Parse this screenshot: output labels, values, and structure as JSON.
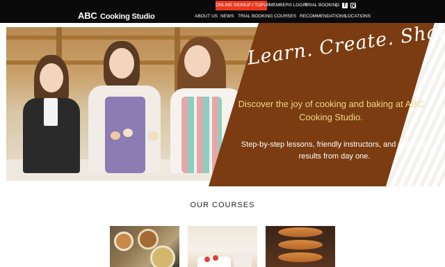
{
  "header": {
    "logo": {
      "main": "ABC",
      "sub": "Cooking Studio"
    },
    "utility": {
      "signup": "ONLINE SIGNUP / TOPUP",
      "login": "MEMBERS LOGIN",
      "trial": "TRIAL BOOKING",
      "separator": "|"
    },
    "social": [
      "facebook-icon",
      "instagram-icon"
    ],
    "nav": [
      "ABOUT US",
      "NEWS",
      "TRIAL BOOKING",
      "COURSES",
      "RECOMMENDATIONS",
      "LOCATIONS"
    ]
  },
  "hero": {
    "tagline": "Learn. Create. Share.",
    "headline": "Discover the joy of cooking and baking at ABC Cooking Studio.",
    "description": "Step-by-step lessons, friendly instructors, and delicious results from day one."
  },
  "courses": {
    "title": "OUR COURSES"
  },
  "colors": {
    "header_bg": "#0a0a0a",
    "signup_bg": "#e8391f",
    "panel_brown": "#7a3c10",
    "headline_gold": "#f3d68a"
  }
}
